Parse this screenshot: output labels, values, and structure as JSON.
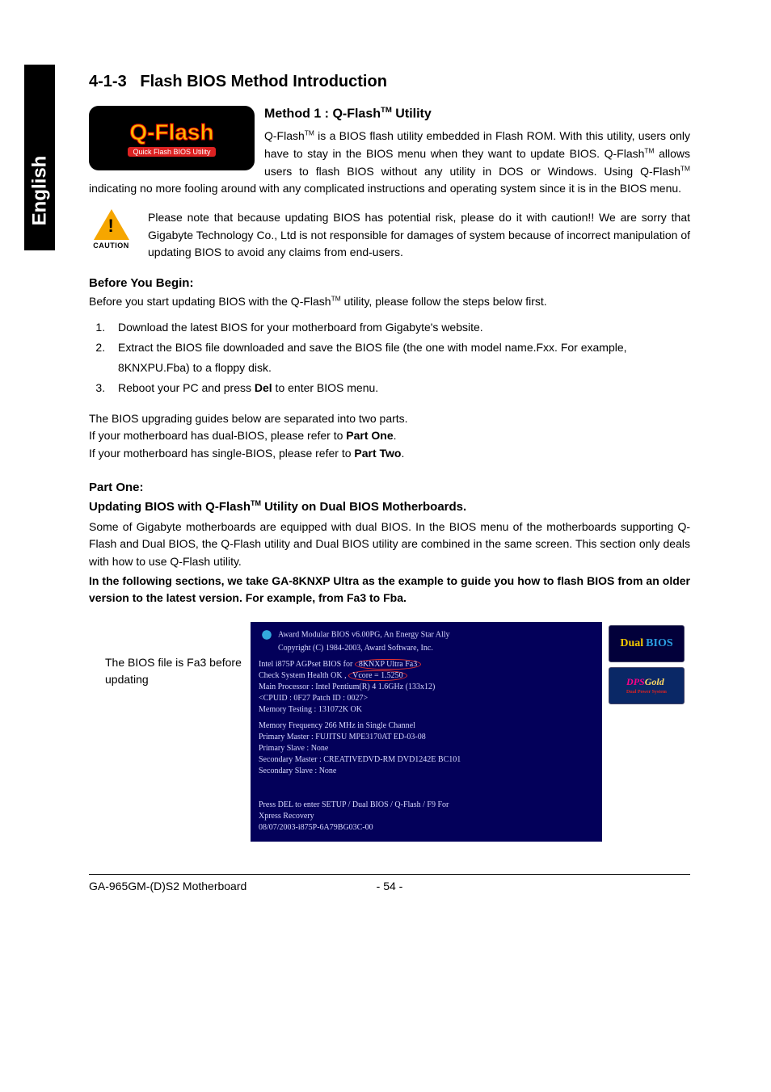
{
  "sideTab": "English",
  "section": {
    "number": "4-1-3",
    "title": "Flash BIOS Method Introduction"
  },
  "logo": {
    "title": "Q-Flash",
    "subtitle": "Quick Flash BIOS Utility"
  },
  "method1": {
    "heading_pre": "Method 1 : Q-Flash",
    "heading_tm": "TM",
    "heading_post": " Utility",
    "para_pre": "Q-Flash",
    "para_tm1": "TM",
    "para_mid1": " is a BIOS flash utility embedded in Flash ROM. With this utility, users only have to stay in the BIOS menu when they want to update BIOS. Q-Flash",
    "para_tm2": "TM",
    "para_mid2": " allows users to flash BIOS without any utility in DOS or Windows. Using Q-Flash",
    "para_tm3": "TM",
    "para_post": " indicating no more fooling around with any complicated instructions and operating system since it is in the BIOS menu."
  },
  "caution": {
    "label": "CAUTION",
    "text": "Please note that because updating BIOS has potential risk, please do it with caution!! We are sorry that Gigabyte Technology Co., Ltd is not responsible for damages of system because of incorrect manipulation of updating BIOS to avoid any claims from end-users."
  },
  "before": {
    "heading": "Before You Begin:",
    "intro_pre": "Before you start updating BIOS with the Q-Flash",
    "intro_tm": "TM",
    "intro_post": " utility, please follow the steps below first.",
    "steps": [
      "Download the latest BIOS for your motherboard from Gigabyte's website.",
      "Extract the BIOS file downloaded and save the BIOS file (the one with model name.Fxx. For example, 8KNXPU.Fba) to a floppy disk.",
      {
        "pre": "Reboot your PC and press ",
        "bold": "Del",
        "post": " to enter BIOS menu."
      }
    ],
    "guides_intro": "The BIOS upgrading guides below are separated into two parts.",
    "guides_dual_pre": "If your motherboard has dual-BIOS, please refer to ",
    "guides_dual_bold": "Part One",
    "guides_dual_post": ".",
    "guides_single_pre": "If your motherboard has single-BIOS, please refer to ",
    "guides_single_bold": "Part Two",
    "guides_single_post": "."
  },
  "part_one": {
    "label": "Part One:",
    "heading_pre": "Updating BIOS with Q-Flash",
    "heading_tm": "TM",
    "heading_post": " Utility on Dual BIOS Motherboards.",
    "para": "Some of Gigabyte motherboards are equipped with dual BIOS. In the BIOS menu of the motherboards supporting Q-Flash and Dual BIOS, the Q-Flash utility and Dual BIOS utility are combined in the same screen. This section only deals with how to use Q-Flash utility.",
    "bold_para": "In the following sections, we take GA-8KNXP Ultra as the example to guide you how to flash BIOS from an older version to the latest version. For example, from Fa3 to Fba."
  },
  "bios_caption": "The BIOS file is Fa3 before updating",
  "bios": {
    "l1": "Award Modular BIOS v6.00PG, An Energy Star Ally",
    "l2": "Copyright  (C) 1984-2003, Award Software,  Inc.",
    "l3_pre": "Intel i875P AGPset BIOS for",
    "l3_circ": "8KNXP Ultra Fa3",
    "l4_pre": "Check System Health OK , ",
    "l4_circ": "Vcore = 1.5250",
    "l5": "Main Processor : Intel Pentium(R) 4  1.6GHz (133x12)",
    "l6": "<CPUID : 0F27 Patch ID  : 0027>",
    "l7": "Memory Testing  : 131072K OK",
    "l8": "Memory Frequency 266 MHz in Single Channel",
    "l9": "Primary Master : FUJITSU MPE3170AT ED-03-08",
    "l10": "Primary Slave : None",
    "l11": "Secondary Master : CREATIVEDVD-RM DVD1242E BC101",
    "l12": "Secondary Slave : None",
    "l13": "Press DEL to enter SETUP / Dual BIOS / Q-Flash / F9 For",
    "l14": "Xpress Recovery",
    "l15": "08/07/2003-i875P-6A79BG03C-00"
  },
  "badges": {
    "dual_pre": "Dual",
    "dual_post": "BIOS",
    "dps": "DPS",
    "dps_gold": "Gold",
    "dps_sub": "Dual Power System"
  },
  "footer": {
    "left": "GA-965GM-(D)S2 Motherboard",
    "center": "- 54 -"
  }
}
